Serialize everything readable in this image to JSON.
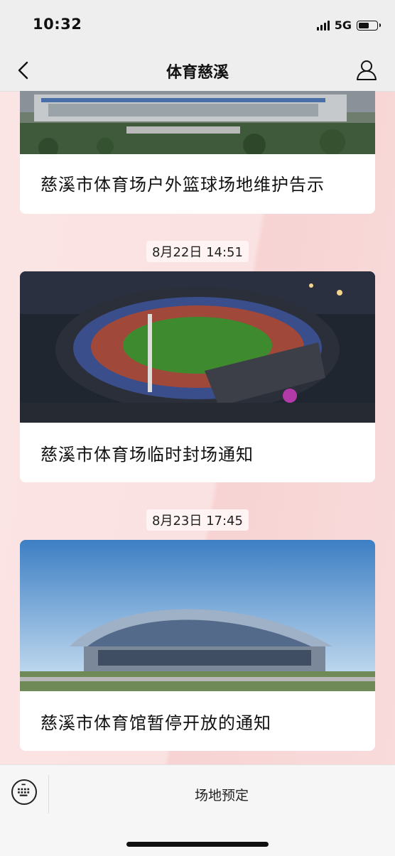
{
  "status_bar": {
    "time": "10:32",
    "network": "5G",
    "battery_level_fraction": 0.65
  },
  "nav": {
    "title": "体育慈溪",
    "back_icon": "chevron-left-icon",
    "profile_icon": "user-icon"
  },
  "messages": [
    {
      "caption": "慈溪市体育场户外篮球场地维护告示",
      "image": "stadium-aerial-day"
    },
    {
      "timestamp": "8月22日 14:51",
      "caption": "慈溪市体育场临时封场通知",
      "image": "stadium-aerial-night"
    },
    {
      "timestamp": "8月23日 17:45",
      "caption": "慈溪市体育馆暂停开放的通知",
      "image": "gymnasium-rendering"
    }
  ],
  "bottom_menu": {
    "keyboard_icon": "keyboard-icon",
    "label": "场地预定"
  },
  "colors": {
    "background": "#f6dcdc",
    "card": "#ffffff",
    "bar": "#eeeeee"
  }
}
